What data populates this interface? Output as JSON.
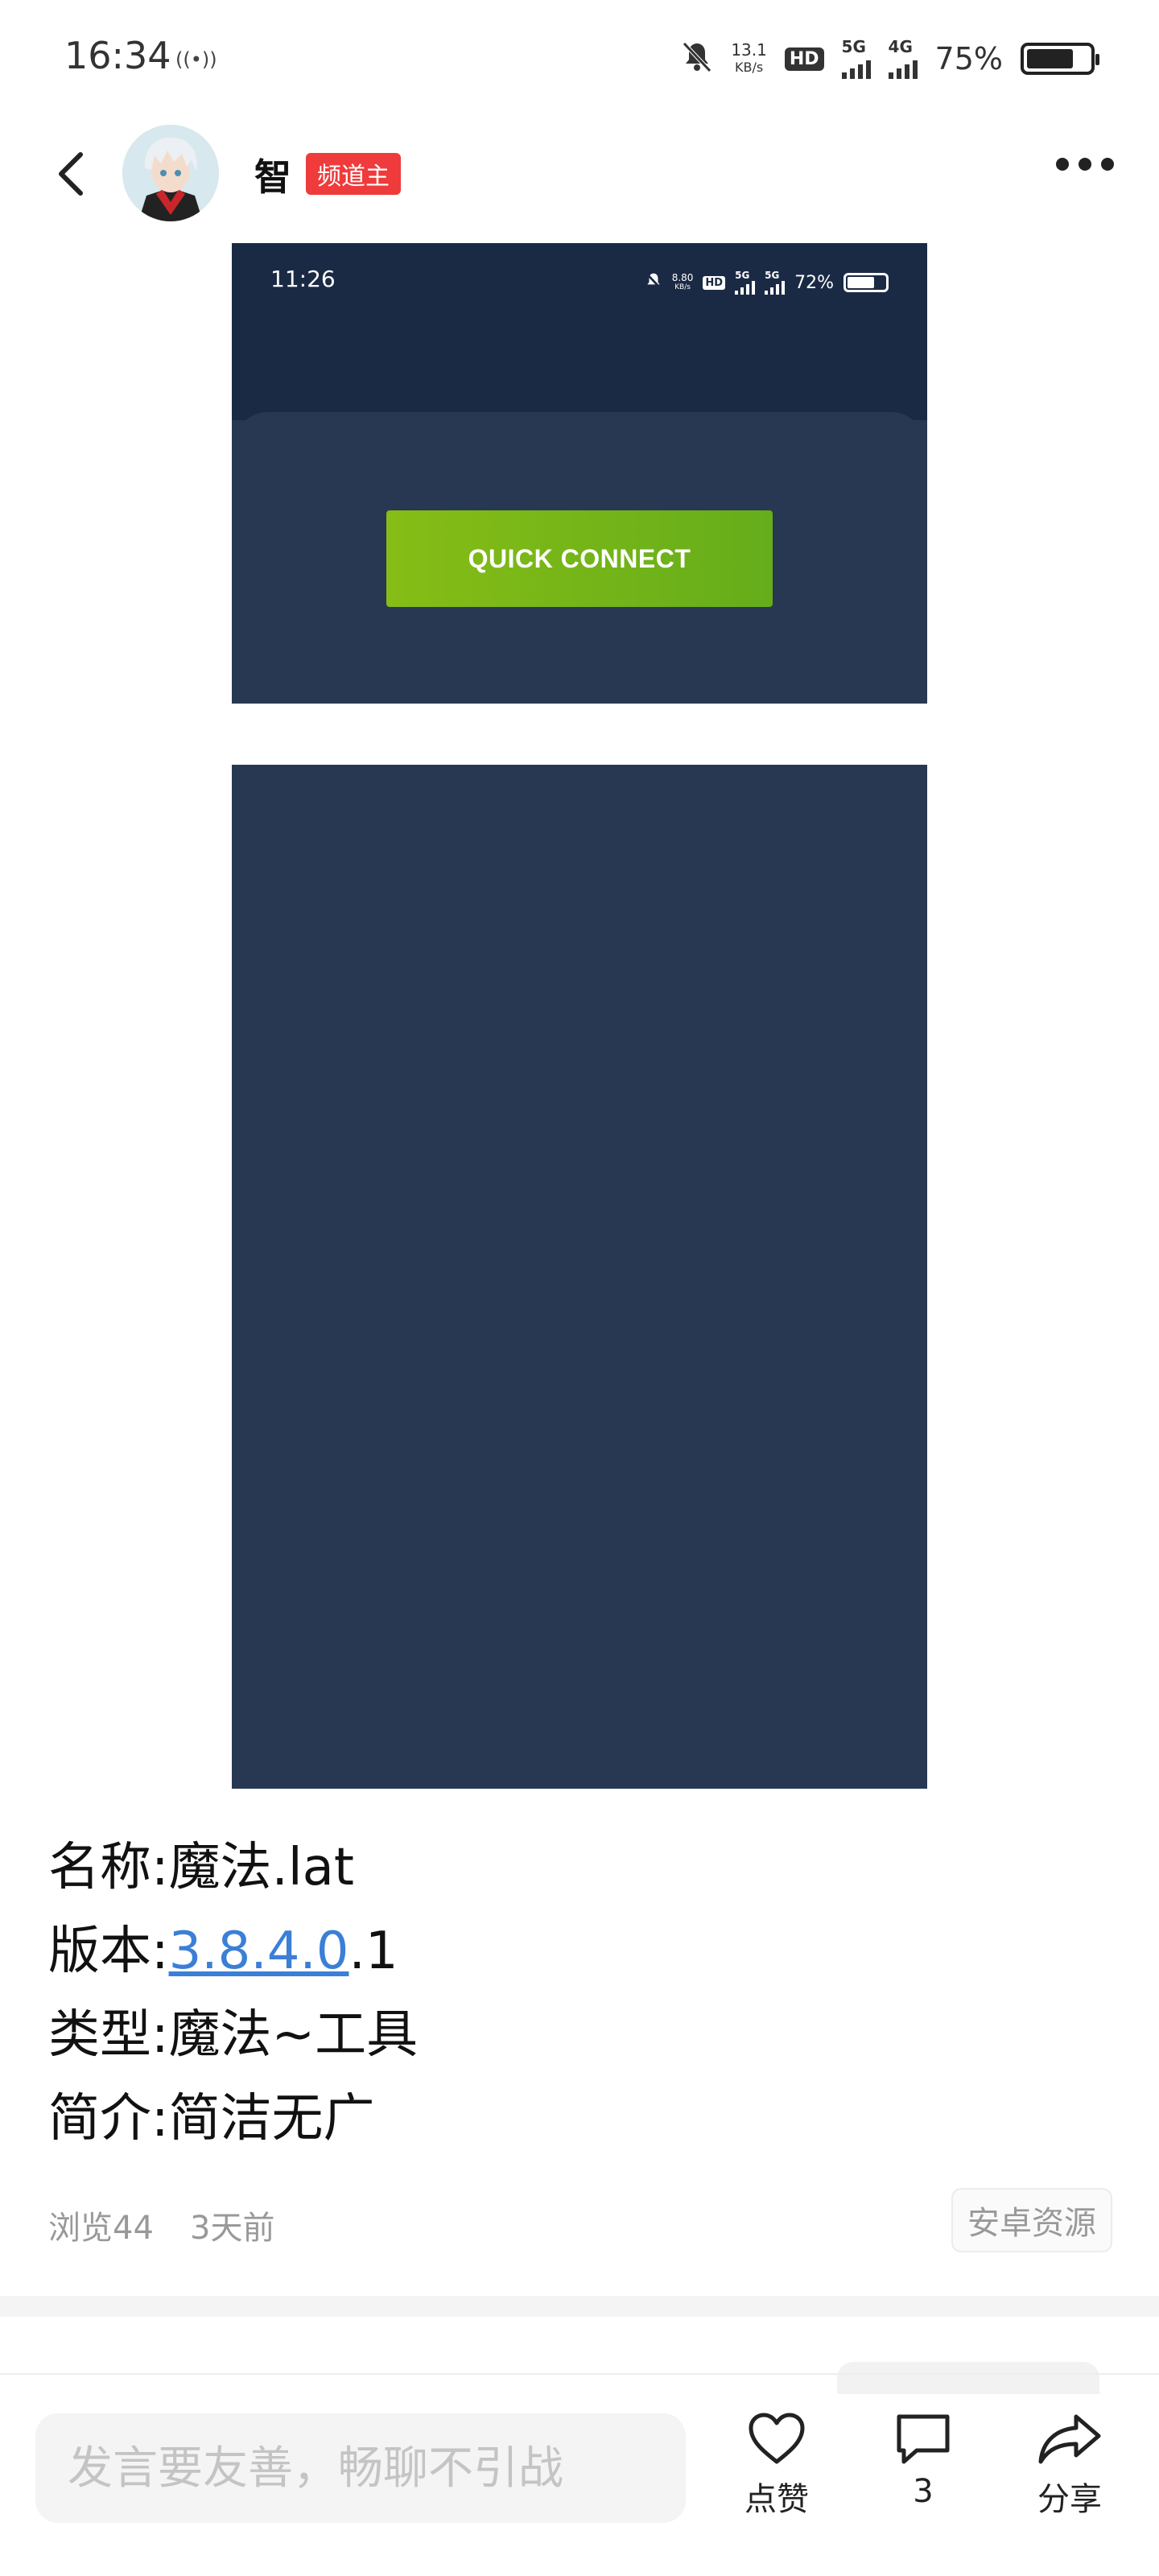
{
  "status_bar": {
    "time": "16:34",
    "signal_glyph": "((•))",
    "net_speed_value": "13.1",
    "net_speed_unit": "KB/s",
    "hd_label": "HD",
    "net_5g": "5G",
    "net_4g": "4G",
    "battery_percent": "75%",
    "battery_level": 0.75
  },
  "header": {
    "author_name": "智",
    "badge": "频道主",
    "icons": {
      "back": "chevron-left-icon",
      "more": "more-dots-icon"
    }
  },
  "embedded_screenshot": {
    "time": "11:26",
    "net_speed_value": "8.80",
    "net_speed_unit": "KB/s",
    "hd_label": "HD",
    "net_5g_a": "5G",
    "net_5g_b": "5G",
    "battery_percent": "72%",
    "battery_level": 0.72,
    "button_label": "QUICK CONNECT",
    "colors": {
      "background": "#283852",
      "top": "#1b2a44",
      "button": "#7ab417"
    }
  },
  "post": {
    "name_prefix": "名称:",
    "name_value": "魔法.lat",
    "version_prefix": "版本:",
    "version_link": "3.8.4.0",
    "version_suffix": ".1",
    "type_prefix": "类型:",
    "type_value": "魔法~工具",
    "intro_prefix": "简介:",
    "intro_value": "简洁无广",
    "views": "浏览44",
    "time_ago": "3天前",
    "tag": "安卓资源"
  },
  "bottom_bar": {
    "comment_placeholder": "发言要友善，畅聊不引战",
    "like_label": "点赞",
    "comment_count": "3",
    "share_label": "分享",
    "icons": {
      "like": "heart-icon",
      "comment": "speech-bubble-icon",
      "share": "share-arrow-icon"
    }
  },
  "colors": {
    "badge": "#ef3b3b",
    "link": "#3b7fd6",
    "muted": "#999999"
  }
}
